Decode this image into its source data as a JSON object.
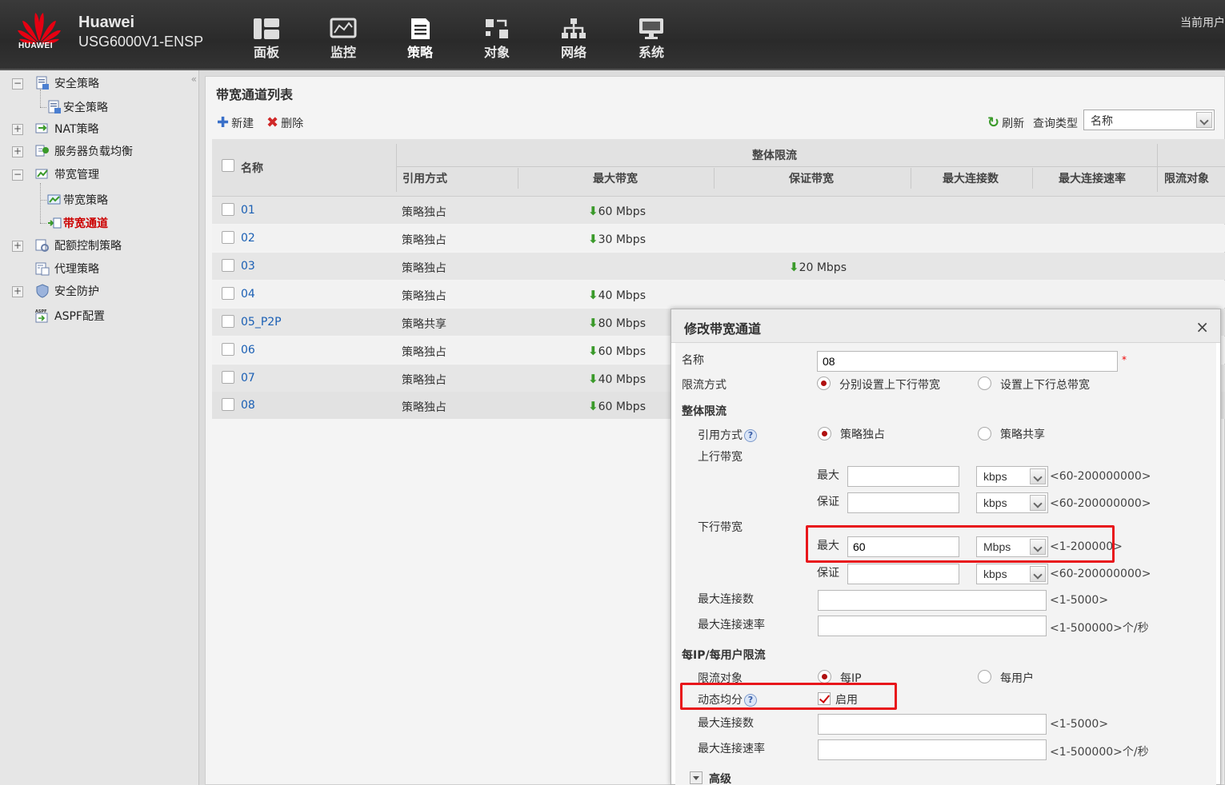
{
  "header": {
    "brand_name": "Huawei",
    "brand_model": "USG6000V1-ENSP",
    "logo_text": "HUAWEI",
    "current_user": "当前用户",
    "nav": [
      {
        "label": "面板",
        "icon": "dashboard-icon"
      },
      {
        "label": "监控",
        "icon": "monitor-icon"
      },
      {
        "label": "策略",
        "icon": "policy-icon",
        "active": true
      },
      {
        "label": "对象",
        "icon": "object-icon"
      },
      {
        "label": "网络",
        "icon": "network-icon"
      },
      {
        "label": "系统",
        "icon": "system-icon"
      }
    ]
  },
  "sidebar": {
    "collapse": "«",
    "items": [
      {
        "label": "安全策略",
        "toggle": "−"
      },
      {
        "label": "安全策略"
      },
      {
        "label": "NAT策略",
        "toggle": "+"
      },
      {
        "label": "服务器负载均衡",
        "toggle": "+"
      },
      {
        "label": "带宽管理",
        "toggle": "−"
      },
      {
        "label": "带宽策略"
      },
      {
        "label": "带宽通道",
        "selected": true
      },
      {
        "label": "配额控制策略",
        "toggle": "+"
      },
      {
        "label": "代理策略"
      },
      {
        "label": "安全防护",
        "toggle": "+"
      },
      {
        "label": "ASPF配置"
      }
    ]
  },
  "main": {
    "title": "带宽通道列表",
    "toolbar": {
      "new_label": "新建",
      "delete_label": "删除",
      "refresh_label": "刷新",
      "query_type_label": "查询类型",
      "query_type_value": "名称"
    },
    "table": {
      "headers": {
        "name": "名称",
        "group": "整体限流",
        "ref_mode": "引用方式",
        "max_bw": "最大带宽",
        "guar_bw": "保证带宽",
        "max_conn": "最大连接数",
        "max_conn_rate": "最大连接速率",
        "limit_target": "限流对象"
      },
      "rows": [
        {
          "name": "01",
          "ref_mode": "策略独占",
          "max_bw": "60 Mbps",
          "guar_bw": ""
        },
        {
          "name": "02",
          "ref_mode": "策略独占",
          "max_bw": "30 Mbps",
          "guar_bw": ""
        },
        {
          "name": "03",
          "ref_mode": "策略独占",
          "max_bw": "",
          "guar_bw": "20 Mbps"
        },
        {
          "name": "04",
          "ref_mode": "策略独占",
          "max_bw": "40 Mbps",
          "guar_bw": ""
        },
        {
          "name": "05_P2P",
          "ref_mode": "策略共享",
          "max_bw": "80 Mbps",
          "guar_bw": ""
        },
        {
          "name": "06",
          "ref_mode": "策略独占",
          "max_bw": "60 Mbps",
          "guar_bw": ""
        },
        {
          "name": "07",
          "ref_mode": "策略独占",
          "max_bw": "40 Mbps",
          "guar_bw": ""
        },
        {
          "name": "08",
          "ref_mode": "策略独占",
          "max_bw": "60 Mbps",
          "guar_bw": ""
        }
      ]
    }
  },
  "dialog": {
    "title": "修改带宽通道",
    "close": "×",
    "name_label": "名称",
    "name_value": "08",
    "required_mark": "*",
    "limit_mode_label": "限流方式",
    "limit_mode_opt1": "分别设置上下行带宽",
    "limit_mode_opt2": "设置上下行总带宽",
    "overall_section": "整体限流",
    "ref_mode_label": "引用方式",
    "help_mark": "?",
    "ref_opt1": "策略独占",
    "ref_opt2": "策略共享",
    "upstream_label": "上行带宽",
    "downstream_label": "下行带宽",
    "max_label": "最大",
    "guar_label": "保证",
    "up_max_value": "",
    "up_max_unit": "kbps",
    "up_max_range": "<60-200000000>",
    "up_guar_value": "",
    "up_guar_unit": "kbps",
    "up_guar_range": "<60-200000000>",
    "down_max_value": "60",
    "down_max_unit": "Mbps",
    "down_max_range": "<1-200000>",
    "down_guar_value": "",
    "down_guar_unit": "kbps",
    "down_guar_range": "<60-200000000>",
    "max_conn_label": "最大连接数",
    "max_conn_range": "<1-5000>",
    "max_conn_rate_label": "最大连接速率",
    "max_conn_rate_range": "<1-500000>个/秒",
    "per_ip_section": "每IP/每用户限流",
    "target_label": "限流对象",
    "target_opt1": "每IP",
    "target_opt2": "每用户",
    "dynamic_label": "动态均分",
    "dynamic_enable": "启用",
    "per_max_conn_label": "最大连接数",
    "per_max_conn_range": "<1-5000>",
    "per_max_conn_rate_label": "最大连接速率",
    "per_max_conn_rate_range": "<1-500000>个/秒",
    "advanced_label": "高级",
    "highlight_color": "#e8161b"
  }
}
